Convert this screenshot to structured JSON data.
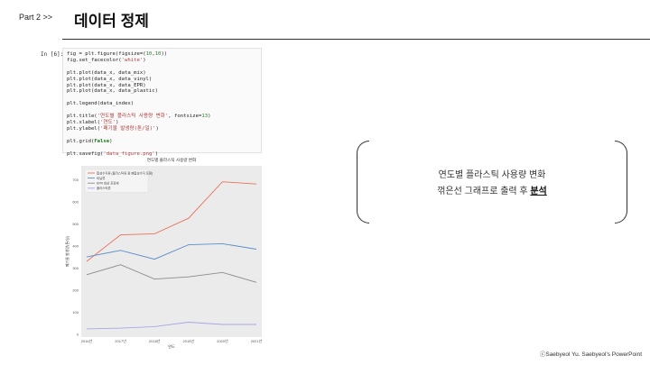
{
  "header": {
    "part": "Part 2  >>",
    "title": "데이터 정제"
  },
  "code": {
    "prompt": "In [6]:",
    "lines": [
      "fig = plt.figure(figsize=(10,10))",
      "fig.set_facecolor('white')",
      "",
      "plt.plot(data_x, data_mix)",
      "plt.plot(data_x, data_vinyl)",
      "plt.plot(data_x, data_EPR)",
      "plt.plot(data_x, data_plastic)",
      "",
      "plt.legend(data_index)",
      "",
      "plt.title('연도별 플라스틱 사용량 변화', fontsize=13)",
      "plt.xlabel('연도')",
      "plt.ylabel('폐기물 발생량(톤/일)')",
      "",
      "plt.grid(False)",
      "",
      "plt.savefig('data_figure.png')"
    ]
  },
  "callout": {
    "line1": "연도별 플라스틱 사용량 변화",
    "line2_prefix": "꺾은선 그래프로 출력 후 ",
    "line2_emph": "분석"
  },
  "footer": {
    "copyright": "ⓒSaebyeol Yu. Saebyeol's PowerPoint"
  },
  "chart_data": {
    "type": "line",
    "title": "연도별 플라스틱 사용량 변화",
    "xlabel": "연도",
    "ylabel": "폐기물 발생량(톤/일)",
    "categories": [
      "2016년",
      "2017년",
      "2018년",
      "2019년",
      "2020년",
      "2021년"
    ],
    "ylim": [
      0,
      750
    ],
    "yticks": [
      0,
      100,
      200,
      300,
      400,
      500,
      600,
      700
    ],
    "grid": false,
    "legend_position": "top-left",
    "series": [
      {
        "name": "합성수지류 (플라스틱류 중 폐합성수지 포함)",
        "color": "#e8735a",
        "values": [
          330,
          450,
          455,
          525,
          690,
          680
        ]
      },
      {
        "name": "비닐류",
        "color": "#5b8fc9",
        "values": [
          350,
          380,
          340,
          405,
          410,
          385
        ]
      },
      {
        "name": "EPR 대상 포장재",
        "color": "#8c8c8c",
        "values": [
          270,
          315,
          250,
          260,
          280,
          235
        ]
      },
      {
        "name": "플라스틱류",
        "color": "#a7a7e6",
        "values": [
          25,
          28,
          35,
          55,
          45,
          45
        ]
      }
    ]
  }
}
